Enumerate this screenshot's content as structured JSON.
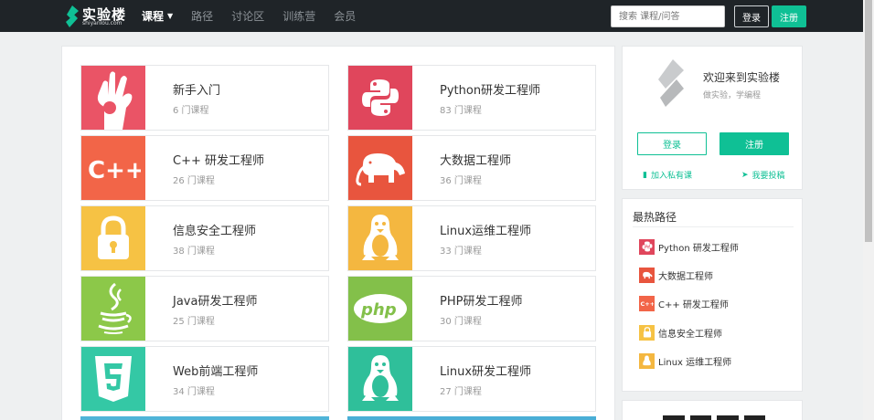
{
  "header": {
    "logo_text": "实验楼",
    "logo_sub": "shiyanlou.com",
    "nav": [
      {
        "label": "课程",
        "active": true
      },
      {
        "label": "路径",
        "active": false
      },
      {
        "label": "讨论区",
        "active": false
      },
      {
        "label": "训练营",
        "active": false
      },
      {
        "label": "会员",
        "active": false
      }
    ],
    "search_placeholder": "搜索 课程/问答",
    "login_label": "登录",
    "register_label": "注册"
  },
  "courses": [
    {
      "title": "新手入门",
      "count": "6 门课程",
      "color": "#ea5466",
      "icon": "ok-hand-icon"
    },
    {
      "title": "Python研发工程师",
      "count": "83 门课程",
      "color": "#e0465c",
      "icon": "python-icon"
    },
    {
      "title": "C++ 研发工程师",
      "count": "26 门课程",
      "color": "#f26548",
      "icon": "cpp-icon"
    },
    {
      "title": "大数据工程师",
      "count": "36 门课程",
      "color": "#e8553e",
      "icon": "hadoop-elephant-icon"
    },
    {
      "title": "信息安全工程师",
      "count": "38 门课程",
      "color": "#f6c244",
      "icon": "padlock-icon"
    },
    {
      "title": "Linux运维工程师",
      "count": "33 门课程",
      "color": "#f4b740",
      "icon": "tux-penguin-icon"
    },
    {
      "title": "Java研发工程师",
      "count": "25 门课程",
      "color": "#8cc849",
      "icon": "java-cup-icon"
    },
    {
      "title": "PHP研发工程师",
      "count": "30 门课程",
      "color": "#83c04a",
      "icon": "php-icon"
    },
    {
      "title": "Web前端工程师",
      "count": "34 门课程",
      "color": "#34c8a5",
      "icon": "html5-icon"
    },
    {
      "title": "Linux研发工程师",
      "count": "27 门课程",
      "color": "#2fbf9a",
      "icon": "tux-penguin-icon"
    }
  ],
  "welcome": {
    "title": "欢迎来到实验楼",
    "subtitle": "做实验，学编程",
    "login_label": "登录",
    "register_label": "注册",
    "link_private": "加入私有课",
    "link_contribute": "我要投稿"
  },
  "hot_paths": {
    "title": "最热路径",
    "items": [
      {
        "label": "Python 研发工程师",
        "color": "#e0465c",
        "icon": "python-icon"
      },
      {
        "label": "大数据工程师",
        "color": "#e8553e",
        "icon": "hadoop-elephant-icon"
      },
      {
        "label": "C++ 研发工程师",
        "color": "#f26548",
        "icon": "cpp-icon"
      },
      {
        "label": "信息安全工程师",
        "color": "#f6c244",
        "icon": "padlock-icon"
      },
      {
        "label": "Linux 运维工程师",
        "color": "#f4b740",
        "icon": "tux-penguin-icon"
      }
    ]
  }
}
